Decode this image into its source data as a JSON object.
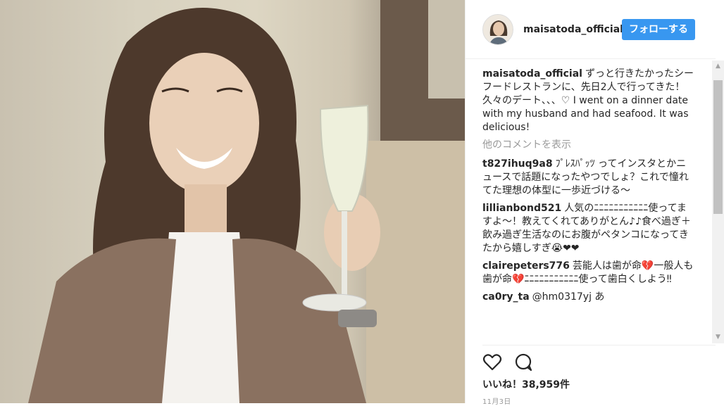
{
  "post": {
    "username": "maisatoda_official",
    "follow_label": "フォローする",
    "caption": {
      "user": "maisatoda_official",
      "text": "ずっと行きたかったシーフードレストランに、先日2人で行ってきた！久々のデート、、、♡ I went on a dinner date with my husband and had seafood. It was delicious!"
    },
    "view_more_comments": "他のコメントを表示",
    "comments": [
      {
        "user": "t827ihuq9a8",
        "text": "ﾌﾟﾚｽﾊﾟｯﾂ ってインスタとかニュースで話題になったやつでしょ？これで憧れてた理想の体型に一歩近づける〜"
      },
      {
        "user": "lillianbond521",
        "text": "人気のﾆﾆﾆﾆﾆﾆﾆﾆﾆﾆﾆ使ってますよ〜！教えてくれてありがとん♪♪食べ過ぎ＋飲み過ぎ生活なのにお腹がペタンコになってきたから嬉しすぎ😭❤❤"
      },
      {
        "user": "clairepeters776",
        "text": "芸能人は歯が命💔一般人も歯が命💔ﾆﾆﾆﾆﾆﾆﾆﾆﾆﾆﾆ使って歯白くしよう‼"
      },
      {
        "user": "ca0ry_ta",
        "text": "@hm0317yj あ"
      }
    ],
    "likes_label": "いいね！38,959件",
    "date": "11月3日"
  },
  "icons": {
    "like": "heart-icon",
    "comment": "comment-icon",
    "scroll_up": "chevron-up-icon",
    "scroll_down": "chevron-down-icon"
  },
  "colors": {
    "accent": "#3897f0",
    "text": "#262626",
    "muted": "#999999"
  }
}
